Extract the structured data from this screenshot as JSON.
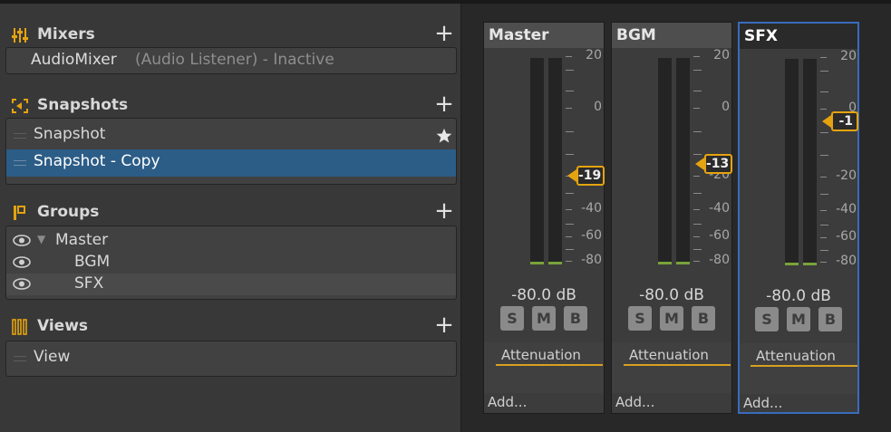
{
  "sections": {
    "mixers": {
      "title": "Mixers",
      "add_icon": "plus-icon",
      "item": {
        "name": "AudioMixer",
        "status": "(Audio Listener) - Inactive"
      }
    },
    "snapshots": {
      "title": "Snapshots",
      "add_icon": "plus-icon",
      "items": [
        {
          "label": "Snapshot",
          "starred": true
        },
        {
          "label": "Snapshot - Copy",
          "selected": true
        }
      ]
    },
    "groups": {
      "title": "Groups",
      "add_icon": "plus-icon",
      "items": [
        {
          "label": "Master",
          "expanded": true
        },
        {
          "label": "BGM"
        },
        {
          "label": "SFX"
        }
      ]
    },
    "views": {
      "title": "Views",
      "add_icon": "plus-icon",
      "items": [
        {
          "label": "View"
        }
      ]
    }
  },
  "scale_labels": [
    "20",
    "0",
    "-20",
    "-40",
    "-60",
    "-80"
  ],
  "strips": [
    {
      "name": "Master",
      "volume": "-19",
      "level": "-80.0 dB",
      "effect": "Attenuation",
      "add": "Add...",
      "buttons": [
        "S",
        "M",
        "B"
      ],
      "selected": false
    },
    {
      "name": "BGM",
      "volume": "-13",
      "level": "-80.0 dB",
      "effect": "Attenuation",
      "add": "Add...",
      "buttons": [
        "S",
        "M",
        "B"
      ],
      "selected": false
    },
    {
      "name": "SFX",
      "volume": "-1",
      "level": "-80.0 dB",
      "effect": "Attenuation",
      "add": "Add...",
      "buttons": [
        "S",
        "M",
        "B"
      ],
      "selected": true
    }
  ],
  "colors": {
    "accent": "#e5a30f",
    "selection": "#2c5d87",
    "selected_border": "#3a6bbd",
    "meter_level": "#79a33b"
  }
}
